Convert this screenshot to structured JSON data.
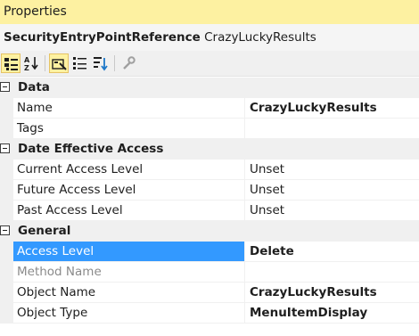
{
  "window": {
    "title": "Properties"
  },
  "object": {
    "type": "SecurityEntryPointReference",
    "name": "CrazyLuckyResults"
  },
  "toolbar": {
    "buttons": [
      {
        "icon": "categorized-icon",
        "active": true
      },
      {
        "icon": "alphabetical-icon",
        "active": false
      },
      {
        "icon": "properties-icon",
        "active": true
      },
      {
        "icon": "events-icon",
        "active": false
      },
      {
        "icon": "sort-icon",
        "active": false
      },
      {
        "icon": "property-pages-icon",
        "active": false
      }
    ]
  },
  "grid": {
    "categories": [
      {
        "label": "Data",
        "props": [
          {
            "name": "Name",
            "value": "CrazyLuckyResults",
            "bold": true
          },
          {
            "name": "Tags",
            "value": ""
          }
        ]
      },
      {
        "label": "Date Effective Access",
        "props": [
          {
            "name": "Current Access Level",
            "value": "Unset"
          },
          {
            "name": "Future Access Level",
            "value": "Unset"
          },
          {
            "name": "Past Access Level",
            "value": "Unset"
          }
        ]
      },
      {
        "label": "General",
        "props": [
          {
            "name": "Access Level",
            "value": "Delete",
            "bold": true,
            "selected": true
          },
          {
            "name": "Method Name",
            "value": "",
            "disabled": true
          },
          {
            "name": "Object Name",
            "value": "CrazyLuckyResults",
            "bold": true
          },
          {
            "name": "Object Type",
            "value": "MenuItemDisplay",
            "bold": true
          }
        ]
      }
    ]
  }
}
